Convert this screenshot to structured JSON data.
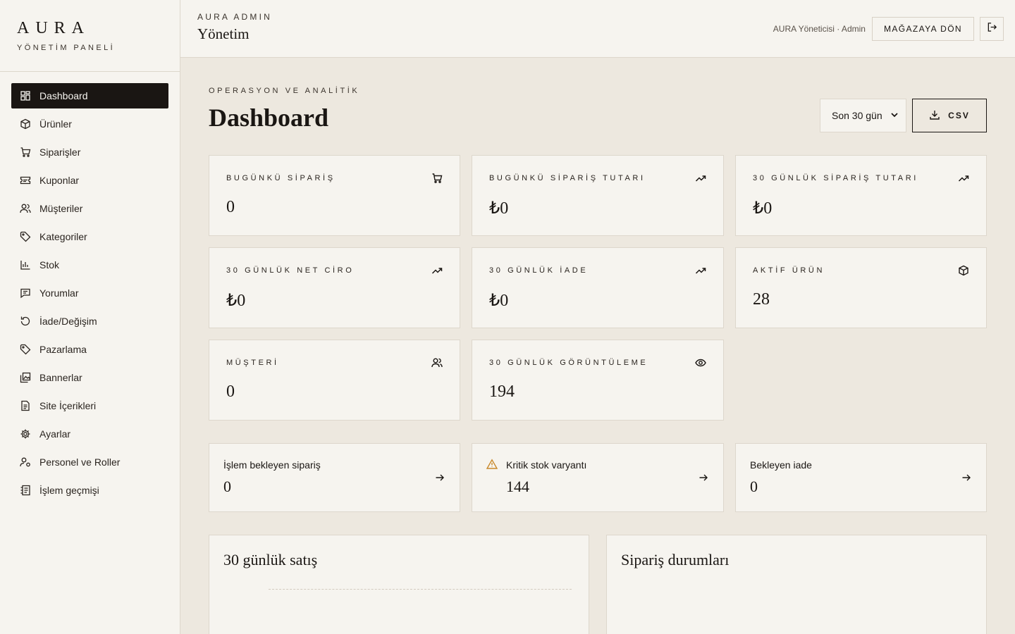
{
  "brand": {
    "logo": "AURA",
    "subtitle": "YÖNETİM PANELİ"
  },
  "nav": [
    {
      "label": "Dashboard",
      "icon": "dashboard-icon",
      "active": true
    },
    {
      "label": "Ürünler",
      "icon": "box-icon"
    },
    {
      "label": "Siparişler",
      "icon": "cart-icon"
    },
    {
      "label": "Kuponlar",
      "icon": "ticket-icon"
    },
    {
      "label": "Müşteriler",
      "icon": "users-icon"
    },
    {
      "label": "Kategoriler",
      "icon": "tag-icon"
    },
    {
      "label": "Stok",
      "icon": "bar-chart-icon"
    },
    {
      "label": "Yorumlar",
      "icon": "message-icon"
    },
    {
      "label": "İade/Değişim",
      "icon": "rotate-icon"
    },
    {
      "label": "Pazarlama",
      "icon": "tag-icon"
    },
    {
      "label": "Bannerlar",
      "icon": "images-icon"
    },
    {
      "label": "Site İçerikleri",
      "icon": "document-icon"
    },
    {
      "label": "Ayarlar",
      "icon": "gear-icon"
    },
    {
      "label": "Personel ve Roller",
      "icon": "user-role-icon"
    },
    {
      "label": "İşlem geçmişi",
      "icon": "log-icon"
    }
  ],
  "header": {
    "eyebrow": "AURA ADMIN",
    "title": "Yönetim",
    "user": "AURA Yöneticisi · Admin",
    "store_button": "MAĞAZAYA DÖN"
  },
  "main": {
    "eyebrow": "OPERASYON VE ANALİTİK",
    "title": "Dashboard",
    "range": "Son 30 gün",
    "csv_label": "CSV"
  },
  "stats": [
    {
      "label": "BUGÜNKÜ SİPARİŞ",
      "value": "0",
      "icon": "cart-icon"
    },
    {
      "label": "BUGÜNKÜ SİPARİŞ TUTARI",
      "value": "₺0",
      "icon": "trending-up-icon"
    },
    {
      "label": "30 GÜNLÜK SİPARİŞ TUTARI",
      "value": "₺0",
      "icon": "trending-up-icon"
    },
    {
      "label": "30 GÜNLÜK NET CİRO",
      "value": "₺0",
      "icon": "trending-up-icon"
    },
    {
      "label": "30 GÜNLÜK İADE",
      "value": "₺0",
      "icon": "trending-up-icon"
    },
    {
      "label": "AKTİF ÜRÜN",
      "value": "28",
      "icon": "box-icon"
    },
    {
      "label": "MÜŞTERİ",
      "value": "0",
      "icon": "users-icon"
    },
    {
      "label": "30 GÜNLÜK GÖRÜNTÜLEME",
      "value": "194",
      "icon": "eye-icon"
    }
  ],
  "quick": [
    {
      "label": "İşlem bekleyen sipariş",
      "value": "0"
    },
    {
      "label": "Kritik stok varyantı",
      "value": "144",
      "warning": true
    },
    {
      "label": "Bekleyen iade",
      "value": "0"
    }
  ],
  "panels": {
    "sales_title": "30 günlük satış",
    "status_title": "Sipariş durumları"
  },
  "colors": {
    "accent_dark": "#1a1613",
    "background": "#ede8df",
    "surface": "#f6f4ef",
    "warning": "#c8882a"
  }
}
